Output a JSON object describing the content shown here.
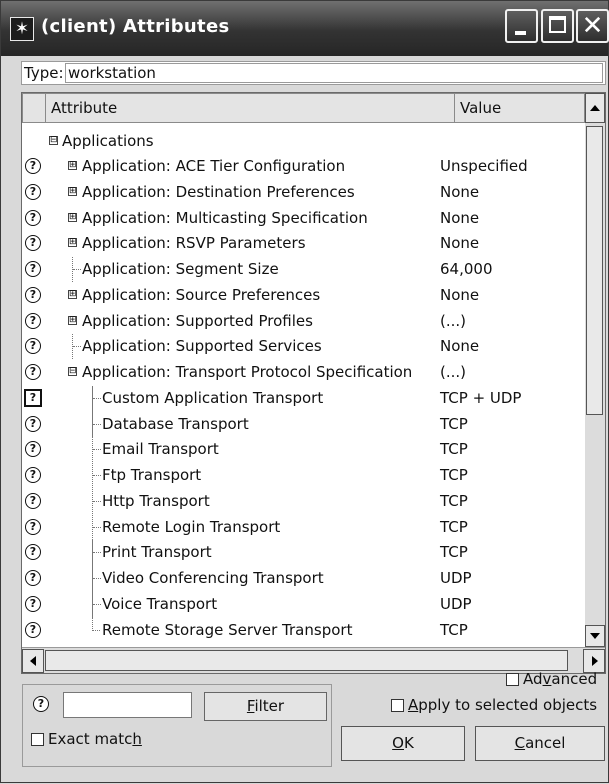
{
  "window": {
    "title": "(client) Attributes",
    "icon": "asterisk-app-icon",
    "controls": {
      "minimize": "minimize-icon",
      "maximize": "maximize-icon",
      "close": "✕"
    }
  },
  "type_row": {
    "label": "Type:",
    "value": "workstation"
  },
  "table": {
    "columns": {
      "attribute": "Attribute",
      "value": "Value"
    },
    "group": {
      "label": "Applications",
      "expander": "⊟"
    },
    "rows": [
      {
        "label": "Application: ACE Tier Configuration",
        "value": "Unspecified",
        "expander": "⊞"
      },
      {
        "label": "Application: Destination Preferences",
        "value": "None",
        "expander": "⊞"
      },
      {
        "label": "Application: Multicasting Specification",
        "value": "None",
        "expander": "⊞"
      },
      {
        "label": "Application: RSVP Parameters",
        "value": "None",
        "expander": "⊞"
      },
      {
        "label": "Application: Segment Size",
        "value": "64,000",
        "expander": ""
      },
      {
        "label": "Application: Source Preferences",
        "value": "None",
        "expander": "⊞"
      },
      {
        "label": "Application: Supported Profiles",
        "value": "(...)",
        "expander": "⊞"
      },
      {
        "label": "Application: Supported Services",
        "value": "None",
        "expander": ""
      },
      {
        "label": "Application: Transport Protocol Specification",
        "value": "(...)",
        "expander": "⊟"
      },
      {
        "label": "Custom Application Transport",
        "value": "TCP + UDP"
      },
      {
        "label": "Database Transport",
        "value": "TCP"
      },
      {
        "label": "Email Transport",
        "value": "TCP"
      },
      {
        "label": "Ftp Transport",
        "value": "TCP"
      },
      {
        "label": "Http Transport",
        "value": "TCP"
      },
      {
        "label": "Remote Login Transport",
        "value": "TCP"
      },
      {
        "label": "Print Transport",
        "value": "TCP"
      },
      {
        "label": "Video Conferencing Transport",
        "value": "UDP"
      },
      {
        "label": "Voice Transport",
        "value": "UDP"
      },
      {
        "label": "Remote Storage Server Transport",
        "value": "TCP"
      }
    ],
    "help_glyph": "?"
  },
  "footer": {
    "filter_input_value": "",
    "filter_button_prefix": "",
    "filter_button_key": "F",
    "filter_button_rest": "ilter",
    "exact_match_pre": "Exact matc",
    "exact_match_key": "h",
    "advanced_pre": "Ad",
    "advanced_key": "v",
    "advanced_post": "anced",
    "apply_key": "A",
    "apply_post": "pply to selected objects",
    "ok_key": "O",
    "ok_post": "K",
    "cancel_key": "C",
    "cancel_post": "ancel"
  }
}
